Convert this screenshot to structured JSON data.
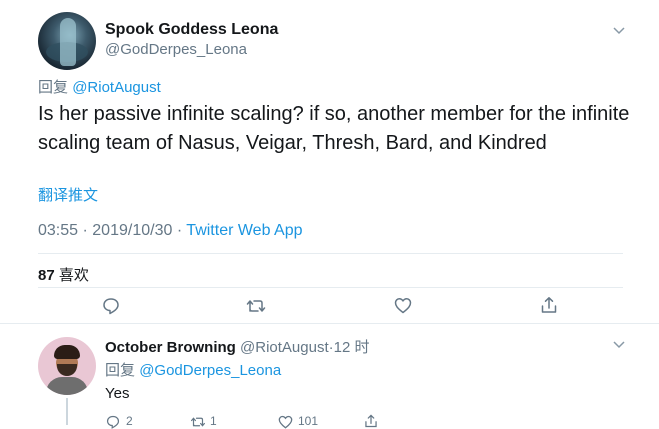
{
  "main_tweet": {
    "author_name": "Spook Goddess Leona",
    "author_handle": "@GodDerpes_Leona",
    "reply_prefix": "回复",
    "reply_to": "@RiotAugust",
    "text": "Is her passive infinite scaling? if so, another member for the infinite scaling team of Nasus, Veigar, Thresh, Bard, and Kindred",
    "translate_label": "翻译推文",
    "time": "03:55",
    "date": "2019/10/30",
    "source": "Twitter Web App",
    "separator": "·",
    "like_count": "87",
    "like_label": "喜欢"
  },
  "reply_tweet": {
    "author_name": "October Browning",
    "author_handle": "@RiotAugust",
    "time_ago": "12 时",
    "separator": "·",
    "reply_prefix": "回复",
    "reply_to": "@GodDerpes_Leona",
    "text": "Yes",
    "reply_count": "2",
    "retweet_count": "1",
    "like_count": "101"
  },
  "icons": [
    "chevron-down-icon",
    "reply-icon",
    "retweet-icon",
    "like-icon",
    "share-icon"
  ],
  "colors": {
    "link": "#1b95e0",
    "secondary_text": "#657786",
    "divider": "#e6ecf0"
  }
}
